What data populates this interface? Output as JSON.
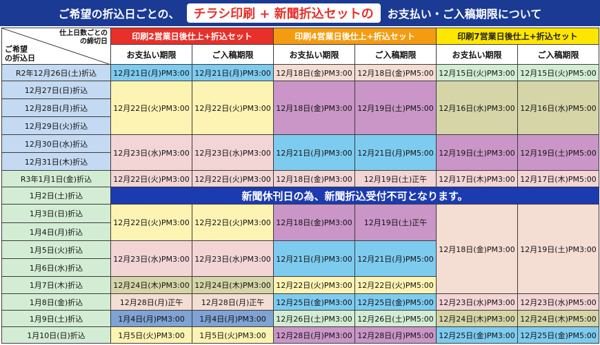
{
  "header": {
    "prefix": "ご希望の折込日ごとの、",
    "highlight": "チラシ印刷 + 新聞折込セットの",
    "suffix": "お支払い・ご入稿期限について"
  },
  "corner": {
    "top_right_line1": "仕上日数ごとの",
    "top_right_line2": "の締切日",
    "bottom_left_line1": "ご希望",
    "bottom_left_line2": "の折込日"
  },
  "groups": [
    {
      "label": "印刷2営業日後仕上+折込セット",
      "bg": "#e8302a",
      "color": "#ffffff"
    },
    {
      "label": "印刷4営業日後仕上+折込セット",
      "bg": "#f39c12",
      "color": "#ffffff"
    },
    {
      "label": "印刷7営業日後仕上+折込セット",
      "bg": "#ffe600",
      "color": "#222222"
    }
  ],
  "subheaders": [
    "お支払い期限",
    "ご入稿期限",
    "お支払い期限",
    "ご入稿期限",
    "お支払い期限",
    "ご入稿期限"
  ],
  "colors": {
    "banner": "#1b3a94",
    "notice": "#1c3bb0",
    "blue": "#7ecbf0",
    "yellow": "#fdf4b3",
    "pink": "#f3d5d6",
    "purple": "#c996c7",
    "olive": "#d5d5a8",
    "peach": "#f4ddd3",
    "ltblue": "#c4daf2",
    "ltgreen": "#d3edd4",
    "steel": "#7fa3d4"
  },
  "notice": "新聞休刊日の為、新聞折込受付不可となります。",
  "rows": [
    {
      "label": "R2年12月26日(土)折込",
      "bg": "ltblue",
      "cells": [
        {
          "t": "12月21日(月)PM3:00",
          "bg": "blue"
        },
        {
          "t": "12月21日(月)PM3:00",
          "bg": "blue"
        },
        {
          "t": "12月18日(金)PM3:00",
          "bg": "peach"
        },
        {
          "t": "12月18日(金)PM5:00",
          "bg": "peach"
        },
        {
          "t": "12月15日(火)PM3:00",
          "bg": "ltgreen"
        },
        {
          "t": "12月15日(火)PM5:00",
          "bg": "ltgreen"
        }
      ]
    },
    {
      "label": "12月27日(日)折込",
      "bg": "ltblue",
      "cells": [
        {
          "t": "12月22日(火)PM3:00",
          "bg": "yellow",
          "rs": 3
        },
        {
          "t": "12月22日(火)PM3:00",
          "bg": "yellow",
          "rs": 3
        },
        {
          "t": "12月18日(金)PM3:00",
          "bg": "purple",
          "rs": 3
        },
        {
          "t": "12月19日(土)PM5:00",
          "bg": "purple",
          "rs": 3
        },
        {
          "t": "12月16日(水)PM3:00",
          "bg": "olive",
          "rs": 3
        },
        {
          "t": "12月16日(水)PM5:00",
          "bg": "olive",
          "rs": 3
        }
      ]
    },
    {
      "label": "12月28日(月)折込",
      "bg": "ltblue",
      "cells": []
    },
    {
      "label": "12月29日(火)折込",
      "bg": "ltblue",
      "cells": []
    },
    {
      "label": "12月30日(水)折込",
      "bg": "ltblue",
      "cells": [
        {
          "t": "12月23日(水)PM3:00",
          "bg": "pink",
          "rs": 2
        },
        {
          "t": "12月23日(水)PM3:00",
          "bg": "pink",
          "rs": 2
        },
        {
          "t": "12月21日(月)PM3:00",
          "bg": "blue",
          "rs": 2
        },
        {
          "t": "12月21日(月)PM5:00",
          "bg": "blue",
          "rs": 2
        },
        {
          "t": "12月19日(土)PM3:00",
          "bg": "purple",
          "rs": 2
        },
        {
          "t": "12月19日(土)PM5:00",
          "bg": "purple",
          "rs": 2
        }
      ]
    },
    {
      "label": "12月31日(木)折込",
      "bg": "ltblue",
      "cells": []
    },
    {
      "label": "R3年1月1日(金)折込",
      "bg": "ltgreen",
      "cells": [
        {
          "t": "12月22日(火)PM3:00",
          "bg": "pink"
        },
        {
          "t": "12月22日(火)PM3:00",
          "bg": "pink"
        },
        {
          "t": "12月18日(金)PM3:00",
          "bg": "pink"
        },
        {
          "t": "12月19日(土)正午",
          "bg": "pink"
        },
        {
          "t": "12月17日(木)PM3:00",
          "bg": "pink"
        },
        {
          "t": "12月17日(木)PM5:00",
          "bg": "pink"
        }
      ]
    },
    {
      "label": "1月2日(土)折込",
      "bg": "ltgreen",
      "notice": true,
      "cells": []
    },
    {
      "label": "1月3日(日)折込",
      "bg": "ltgreen",
      "cells": [
        {
          "t": "12月22日(火)PM3:00",
          "bg": "yellow",
          "rs": 2
        },
        {
          "t": "12月22日(火)PM3:00",
          "bg": "yellow",
          "rs": 2
        },
        {
          "t": "12月18日(金)PM3:00",
          "bg": "purple",
          "rs": 2
        },
        {
          "t": "12月19日(土)正午",
          "bg": "purple",
          "rs": 2
        },
        {
          "t": "12月18日(金)PM3:00",
          "bg": "peach",
          "rs": 5
        },
        {
          "t": "12月19日(土)PM3:00",
          "bg": "peach",
          "rs": 5
        }
      ]
    },
    {
      "label": "1月4日(月)折込",
      "bg": "ltgreen",
      "cells": []
    },
    {
      "label": "1月5日(火)折込",
      "bg": "ltgreen",
      "cells": [
        {
          "t": "12月23日(水)PM3:00",
          "bg": "pink",
          "rs": 2
        },
        {
          "t": "12月23日(水)PM3:00",
          "bg": "pink",
          "rs": 2
        },
        {
          "t": "12月21日(月)PM3:00",
          "bg": "blue",
          "rs": 2
        },
        {
          "t": "12月21日(月)PM5:00",
          "bg": "blue",
          "rs": 2
        }
      ]
    },
    {
      "label": "1月6日(水)折込",
      "bg": "ltgreen",
      "cells": []
    },
    {
      "label": "1月7日(木)折込",
      "bg": "ltgreen",
      "cells": [
        {
          "t": "12月24日(木)PM3:00",
          "bg": "olive"
        },
        {
          "t": "12月24日(木)PM3:00",
          "bg": "olive"
        },
        {
          "t": "12月22日(火)PM3:00",
          "bg": "yellow"
        },
        {
          "t": "12月22日(火)PM5:00",
          "bg": "yellow"
        },
        {
          "t": "12月19日(土)PM3:00",
          "bg": "purple"
        },
        {
          "t": "12月19日(土)PM5:00",
          "bg": "purple"
        }
      ]
    },
    {
      "label": "1月8日(金)折込",
      "bg": "ltgreen",
      "cells": [
        {
          "t": "12月28日(月)正午",
          "bg": "peach"
        },
        {
          "t": "12月28日(月)正午",
          "bg": "peach"
        },
        {
          "t": "12月25日(金)PM3:00",
          "bg": "blue"
        },
        {
          "t": "12月25日(金)PM5:00",
          "bg": "blue"
        },
        {
          "t": "12月23日(水)PM3:00",
          "bg": "pink"
        },
        {
          "t": "12月23日(水)PM5:00",
          "bg": "pink"
        }
      ]
    },
    {
      "label": "1月9日(土)折込",
      "bg": "ltgreen",
      "cells": [
        {
          "t": "1月4日(月)PM3:00",
          "bg": "steel"
        },
        {
          "t": "1月4日(月)PM3:00",
          "bg": "steel"
        },
        {
          "t": "12月26日(土)PM3:00",
          "bg": "ltgreen"
        },
        {
          "t": "12月26日(土)PM5:00",
          "bg": "ltgreen"
        },
        {
          "t": "12月24日(木)PM3:00",
          "bg": "olive"
        },
        {
          "t": "12月24日(木)PM5:00",
          "bg": "olive"
        }
      ]
    },
    {
      "label": "1月10日(日)折込",
      "bg": "ltgreen",
      "cells": [
        {
          "t": "1月5日(火)PM3:00",
          "bg": "yellow"
        },
        {
          "t": "1月5日(火)PM3:00",
          "bg": "yellow"
        },
        {
          "t": "12月28日(月)PM3:00",
          "bg": "purple"
        },
        {
          "t": "12月28日(月)PM5:00",
          "bg": "purple"
        },
        {
          "t": "12月25日(金)PM3:00",
          "bg": "blue"
        },
        {
          "t": "12月25日(金)PM5:00",
          "bg": "blue"
        }
      ]
    }
  ]
}
